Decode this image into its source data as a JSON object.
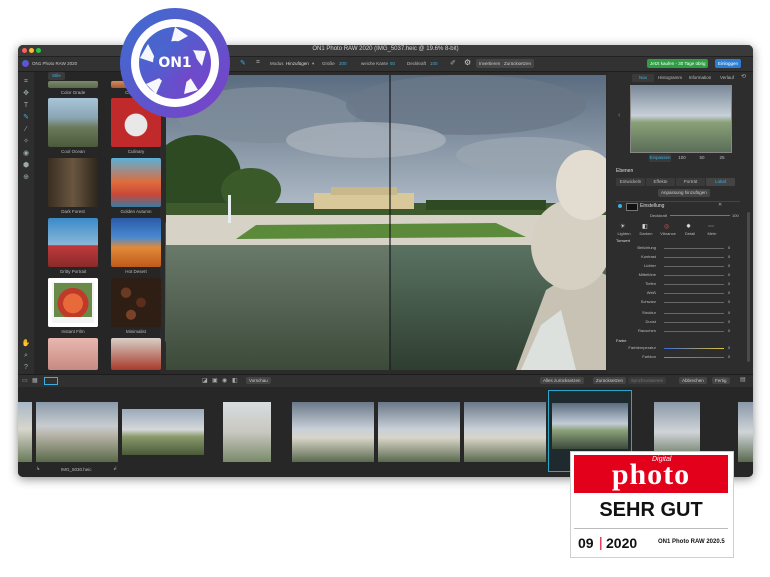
{
  "window": {
    "title": "ON1 Photo RAW 2020 (IMG_5037.heic @ 19.6% 8-bit)",
    "app_name": "ON1 Photo RAW 2020",
    "controls": {
      "close": "#ff5f57",
      "minimize": "#febc2e",
      "zoom": "#28c840"
    }
  },
  "toolbar": {
    "mode_label": "Modus",
    "mode_value": "Hinzufügen",
    "size_label": "Größe",
    "size_value": "200",
    "soft_edge_label": "weiche Kante",
    "soft_edge_value": "50",
    "opacity_label": "Deckkraft",
    "opacity_value": "100",
    "invert_label": "Invertieren",
    "reset_label": "Zurücksetzen",
    "buy_label": "Jetzt kaufen - 30 Tage übrig",
    "buy_color": "#2ea043",
    "login_label": "Einloggen"
  },
  "browser": {
    "tab": "Stile",
    "presets": [
      {
        "label": "Color Grade",
        "icon": "tree-landscape"
      },
      {
        "label": "Color Tone",
        "icon": "sky-landscape"
      },
      {
        "label": "Cool Ocean",
        "icon": "ocean-man"
      },
      {
        "label": "Culinary",
        "icon": "dish"
      },
      {
        "label": "Dark Forest",
        "icon": "forest-woman"
      },
      {
        "label": "Golden Autumn",
        "icon": "town-houses"
      },
      {
        "label": "Gritty Portrait",
        "icon": "red-jacket-man"
      },
      {
        "label": "Hot Desert",
        "icon": "desert-dunes"
      },
      {
        "label": "Instant Film",
        "icon": "flower"
      },
      {
        "label": "Minimalist",
        "icon": "coffee-beans"
      },
      {
        "label": "",
        "icon": "woman-portrait"
      },
      {
        "label": "",
        "icon": "building"
      }
    ],
    "search_placeholder": "Suchen"
  },
  "right_panel": {
    "tabs": [
      "Nav",
      "Histogramm",
      "Information",
      "Verlauf"
    ],
    "zoom_levels": [
      "Einpassen",
      "100",
      "50",
      "25"
    ],
    "layers_title": "Ebenen",
    "edit_tabs": [
      "Entwickeln",
      "Effekte",
      "Porträt",
      "Lokal"
    ],
    "adjust_button": "Anpassung hinzufügen",
    "adjustment_title": "Einstellung",
    "opacity_label": "Deckkraft",
    "opacity_value": "100",
    "presets": [
      "Lighten",
      "Darken",
      "Vibrance",
      "Detail",
      "Mehr"
    ],
    "tone_section": "Tonwert",
    "sliders": [
      {
        "name": "Belichtung",
        "value": "0"
      },
      {
        "name": "Kontrast",
        "value": "0"
      },
      {
        "name": "Lichter",
        "value": "0"
      },
      {
        "name": "Mitteltöne",
        "value": "0"
      },
      {
        "name": "Tiefen",
        "value": "0"
      },
      {
        "name": "Weiß",
        "value": "0"
      },
      {
        "name": "Schwarz",
        "value": "0"
      },
      {
        "name": "Struktur",
        "value": "0"
      },
      {
        "name": "Dunst",
        "value": "0"
      },
      {
        "name": "Rauschen",
        "value": "0"
      }
    ],
    "color_section": "Farbe",
    "color_sliders": [
      {
        "name": "Farbtemperatur",
        "value": "0"
      },
      {
        "name": "Farbton",
        "value": "0"
      }
    ]
  },
  "bottom_bar": {
    "preview_label": "Vorschau",
    "reset_all": "Alles zurücksetzen",
    "reset": "Zurücksetzen",
    "sync": "Synchronisieren",
    "cancel": "Abbrechen",
    "done": "Fertig",
    "accent": "#2aa6c8"
  },
  "filmstrip": {
    "filename": "IMG_5030.heic",
    "count": 10,
    "selected_index": 7
  },
  "logo": {
    "text": "ON1",
    "colors": [
      "#3b6fd0",
      "#7d3fc9"
    ]
  },
  "badge": {
    "brand_top": "Digital",
    "brand": "photo",
    "rating": "SEHR GUT",
    "issue": "09",
    "year": "2020",
    "product": "ON1 Photo RAW 2020.5",
    "color": "#e2001a"
  }
}
